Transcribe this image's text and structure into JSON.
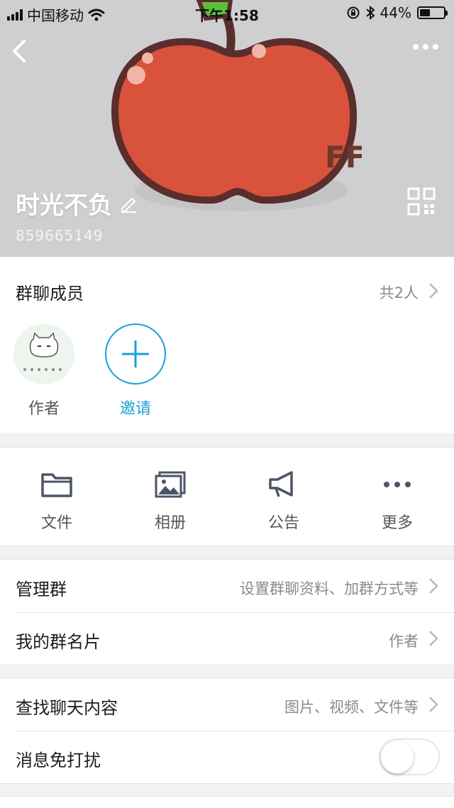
{
  "status_bar": {
    "carrier": "中国移动",
    "time": "下午1:58",
    "battery_percent": "44%",
    "battery_level": 0.44,
    "icons": [
      "signal-icon",
      "wifi-icon",
      "rotation-lock-icon",
      "bluetooth-icon",
      "battery-icon"
    ]
  },
  "header": {
    "group_name": "时光不负",
    "group_id": "859665149",
    "icons": [
      "back-icon",
      "more-icon",
      "edit-icon",
      "qr-code-icon"
    ],
    "accent": "#d8513a"
  },
  "members": {
    "title": "群聊成员",
    "count": "共2人",
    "items": [
      {
        "label": "作者"
      },
      {
        "label": "邀请"
      }
    ],
    "invite_color": "#1aa0d8"
  },
  "actions": {
    "items": [
      {
        "label": "文件",
        "icon": "folder-icon"
      },
      {
        "label": "相册",
        "icon": "album-icon"
      },
      {
        "label": "公告",
        "icon": "announcement-icon"
      },
      {
        "label": "更多",
        "icon": "more-icon"
      }
    ]
  },
  "manage": {
    "rows": [
      {
        "title": "管理群",
        "value": "设置群聊资料、加群方式等"
      },
      {
        "title": "我的群名片",
        "value": "作者"
      }
    ]
  },
  "chat": {
    "rows": [
      {
        "title": "查找聊天内容",
        "value": "图片、视频、文件等"
      },
      {
        "title": "消息免打扰",
        "toggle": false
      }
    ]
  }
}
